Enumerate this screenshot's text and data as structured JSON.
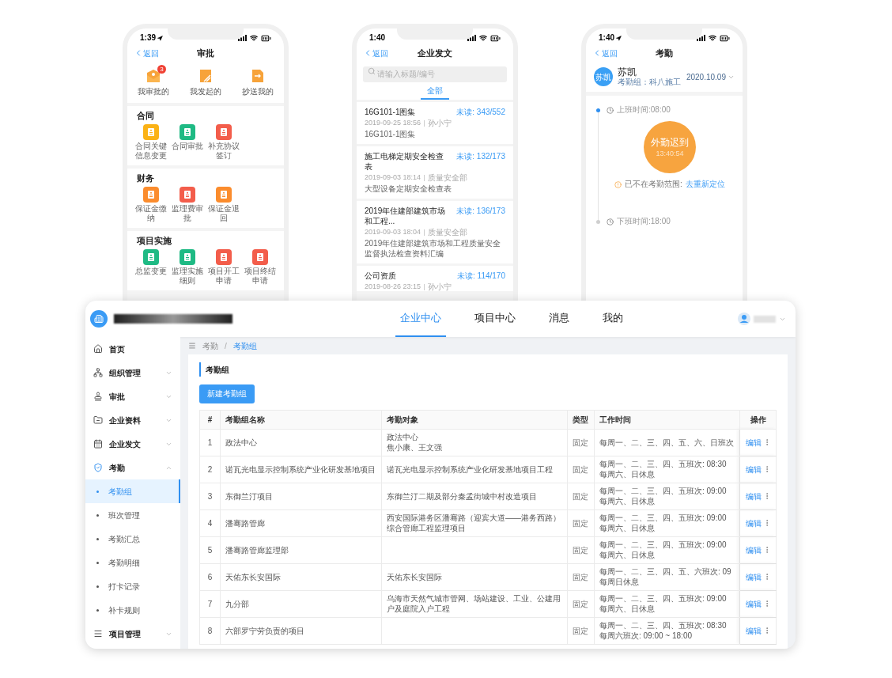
{
  "approval_screen": {
    "time": "1:39",
    "location_icon": true,
    "back": "返回",
    "title": "审批",
    "shortcuts": [
      {
        "label": "我审批的",
        "badge": "3"
      },
      {
        "label": "我发起的"
      },
      {
        "label": "抄送我的"
      }
    ],
    "sections": [
      {
        "title": "合同",
        "items": [
          {
            "label": "合同关键信息变更",
            "color": "#fbb215"
          },
          {
            "label": "合同审批",
            "color": "#1fba84"
          },
          {
            "label": "补充协议签订",
            "color": "#f35d4b"
          }
        ]
      },
      {
        "title": "财务",
        "items": [
          {
            "label": "保证金缴纳",
            "color": "#fb8c2d"
          },
          {
            "label": "监理费审批",
            "color": "#f35d4b"
          },
          {
            "label": "保证金退回",
            "color": "#fb8c2d"
          }
        ]
      },
      {
        "title": "项目实施",
        "items": [
          {
            "label": "总监变更",
            "color": "#1fba84"
          },
          {
            "label": "监理实施细则",
            "color": "#1fba84"
          },
          {
            "label": "项目开工申请",
            "color": "#f35d4b"
          },
          {
            "label": "项目终结申请",
            "color": "#f35d4b"
          }
        ]
      }
    ]
  },
  "documents_screen": {
    "time": "1:40",
    "back": "返回",
    "title": "企业发文",
    "search": {
      "placeholder": "请输入标题/编号"
    },
    "tabs": [
      {
        "label": "全部",
        "selected": true
      }
    ],
    "items": [
      {
        "title": "16G101-1图集",
        "unread": "未读: 343/552",
        "date": "2019-09-25 18:56",
        "author": "孙小宁",
        "summary": "16G101-1图集"
      },
      {
        "title": "施工电梯定期安全检查表",
        "unread": "未读: 132/173",
        "date": "2019-09-03 18:14",
        "author": "质量安全部",
        "summary": "大型设备定期安全检查表"
      },
      {
        "title": "2019年住建部建筑市场和工程...",
        "unread": "未读: 136/173",
        "date": "2019-09-03 18:04",
        "author": "质量安全部",
        "summary": "2019年住建部建筑市场和工程质量安全监督执法检查资料汇编"
      },
      {
        "title": "公司资质",
        "unread": "未读: 114/170",
        "date": "2019-08-26 23:15",
        "author": "孙小宁"
      }
    ]
  },
  "attendance_screen": {
    "time": "1:40",
    "location_icon": true,
    "back": "返回",
    "title": "考勤",
    "user": {
      "avatar": "苏凯",
      "name": "苏凯",
      "group": "考勤组：科八施工"
    },
    "date": "2020.10.09",
    "start": {
      "label": "上班时间:08:00",
      "done": true
    },
    "punch": {
      "status": "外勤迟到",
      "time": "13:40:54"
    },
    "warning": {
      "text": "已不在考勤范围:",
      "link": "去重新定位"
    },
    "end": {
      "label": "下班时间:18:00",
      "done": false
    }
  },
  "desktop": {
    "nav": [
      {
        "label": "企业中心",
        "selected": true
      },
      {
        "label": "项目中心",
        "selected": false
      },
      {
        "label": "消息",
        "selected": false
      },
      {
        "label": "我的",
        "selected": false
      }
    ],
    "sidebar": [
      {
        "label": "首页",
        "active": false
      },
      {
        "label": "组织管理",
        "active": false,
        "expanded": false
      },
      {
        "label": "审批",
        "active": false,
        "expanded": false
      },
      {
        "label": "企业资料",
        "active": false,
        "expanded": false
      },
      {
        "label": "企业发文",
        "active": false,
        "expanded": false
      },
      {
        "label": "考勤",
        "active": true,
        "expanded": true,
        "children": [
          {
            "label": "考勤组",
            "selected": true
          },
          {
            "label": "班次管理",
            "selected": false
          },
          {
            "label": "考勤汇总",
            "selected": false
          },
          {
            "label": "考勤明细",
            "selected": false
          },
          {
            "label": "打卡记录",
            "selected": false
          },
          {
            "label": "补卡规则",
            "selected": false
          }
        ]
      },
      {
        "label": "项目管理",
        "active": false,
        "expanded": false
      }
    ],
    "breadcrumb": [
      "考勤",
      "考勤组"
    ],
    "breadcrumb_separator": "/",
    "card_title": "考勤组",
    "new_button": "新建考勤组",
    "table": {
      "columns": [
        "#",
        "考勤组名称",
        "考勤对象",
        "类型",
        "工作时间",
        "操作"
      ],
      "rows": [
        {
          "index": "1",
          "name": "政法中心",
          "target": [
            "政法中心",
            "焦小康、王文强"
          ],
          "type": "固定",
          "time": [
            "每周一、二、三、四、五、六、日班次"
          ],
          "action": "编辑"
        },
        {
          "index": "2",
          "name": "诺瓦光电显示控制系统产业化研发基地项目",
          "target": [
            "诺瓦光电显示控制系统产业化研发基地项目工程"
          ],
          "type": "固定",
          "time": [
            "每周一、二、三、四、五班次: 08:30",
            "每周六、日休息"
          ],
          "action": "编辑"
        },
        {
          "index": "3",
          "name": "东御兰汀项目",
          "target": [
            "东御兰汀二期及部分秦孟街城中村改造项目"
          ],
          "type": "固定",
          "time": [
            "每周一、二、三、四、五班次: 09:00",
            "每周六、日休息"
          ],
          "action": "编辑"
        },
        {
          "index": "4",
          "name": "潘骞路管廊",
          "target": [
            "西安国际港务区潘骞路（迎宾大道——港务西路）综合管廊工程监理项目"
          ],
          "type": "固定",
          "time": [
            "每周一、二、三、四、五班次: 09:00",
            "每周六、日休息"
          ],
          "action": "编辑"
        },
        {
          "index": "5",
          "name": "潘骞路管廊监理部",
          "type": "固定",
          "time": [
            "每周一、二、三、四、五班次: 09:00",
            "每周六、日休息"
          ],
          "action": "编辑"
        },
        {
          "index": "6",
          "name": "天佑东长安国际",
          "target": [
            "天佑东长安国际"
          ],
          "type": "固定",
          "time": [
            "每周一、二、三、四、五、六班次: 09",
            "每周日休息"
          ],
          "action": "编辑"
        },
        {
          "index": "7",
          "name": "九分部",
          "target": [
            "乌海市天然气城市管网、场站建设、工业、公建用户及庭院入户工程"
          ],
          "type": "固定",
          "time": [
            "每周一、二、三、四、五班次: 09:00",
            "每周六、日休息"
          ],
          "action": "编辑"
        },
        {
          "index": "8",
          "name": "六部罗宁劳负责的项目",
          "type": "固定",
          "time": [
            "每周一、二、三、四、五班次: 08:30",
            "每周六班次: 09:00 ~ 18:00"
          ],
          "action": "编辑"
        }
      ]
    }
  }
}
